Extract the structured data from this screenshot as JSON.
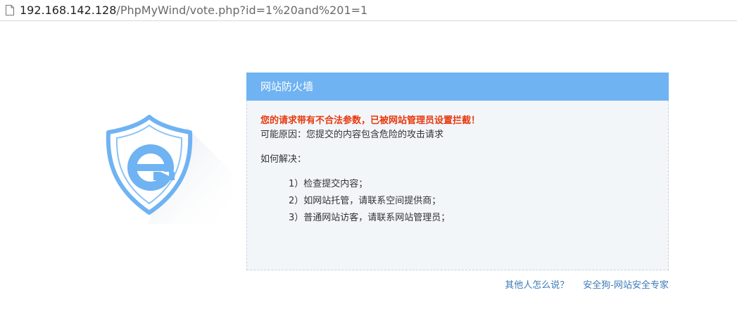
{
  "address_bar": {
    "host": "192.168.142.128",
    "path": "/PhpMyWind/vote.php?id=1%20and%201=1"
  },
  "panel": {
    "title": "网站防火墙",
    "warning": "您的请求带有不合法参数，已被网站管理员设置拦截！",
    "reason": "可能原因：您提交的内容包含危险的攻击请求",
    "how_to": "如何解决：",
    "steps": [
      "1）检查提交内容；",
      "2）如网站托管，请联系空间提供商；",
      "3）普通网站访客，请联系网站管理员；"
    ]
  },
  "footer": {
    "others_link": "其他人怎么说？",
    "brand_link": "安全狗-网站安全专家"
  },
  "colors": {
    "header_bg": "#6fb3f2",
    "warning_text": "#e8380d",
    "link": "#3c7ab8",
    "shield": "#6fb3f2"
  },
  "icons": [
    "page-icon",
    "shield-logo-icon"
  ]
}
